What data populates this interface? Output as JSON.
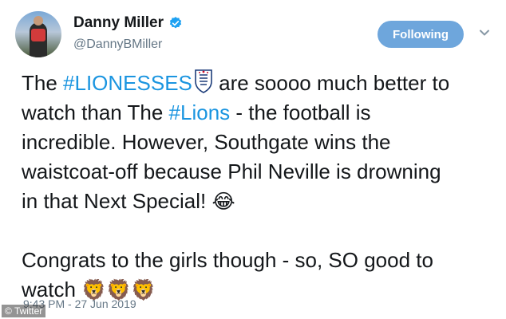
{
  "user": {
    "display_name": "Danny Miller",
    "handle": "@DannyBMiller",
    "verified_icon": "verified-badge-icon",
    "avatar": "profile-photo"
  },
  "actions": {
    "follow_label": "Following",
    "menu_icon": "chevron-down-icon"
  },
  "tweet": {
    "line1_prefix": "The ",
    "hashtag1": "#LIONESSES",
    "line1_suffix": " are soooo much better to",
    "line2_prefix": "watch than The ",
    "hashtag2": "#Lions",
    "line2_suffix": " - the football is",
    "line3": "incredible. However, Southgate wins the",
    "line4": "waistcoat-off because Phil Neville is drowning",
    "line5": "in that Next Special! ",
    "emoji_laugh": "😂",
    "line7": "Congrats to the girls though - so, SO good to",
    "line8": "watch ",
    "emoji_lions": "🦁🦁🦁"
  },
  "timestamp": "9:43 PM - 27 Jun 2019",
  "watermark": "© Twitter",
  "colors": {
    "link": "#1b95e0",
    "follow_button": "#6ea6dc",
    "secondary_text": "#657786"
  }
}
